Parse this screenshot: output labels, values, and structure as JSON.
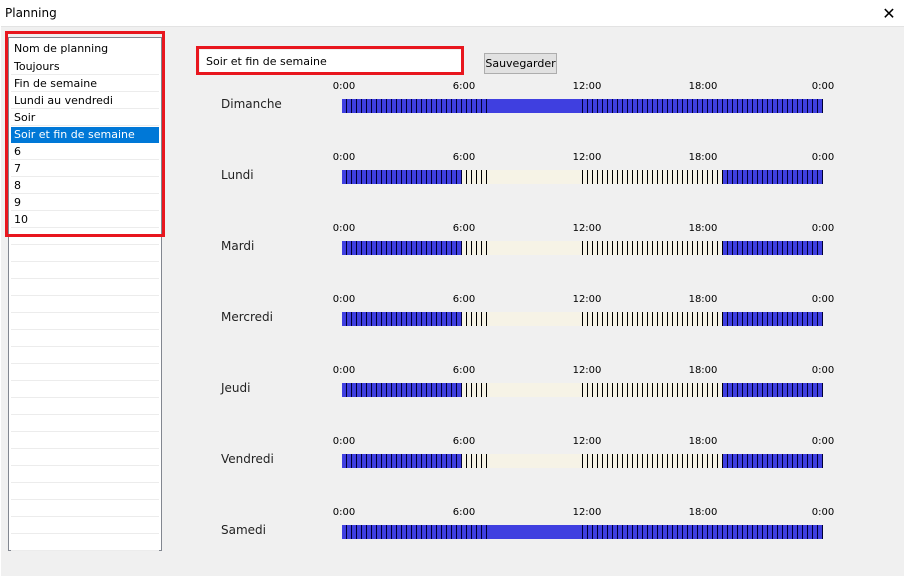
{
  "window": {
    "title": "Planning",
    "close_glyph": "✕"
  },
  "sidebar": {
    "header": "Nom de planning",
    "items": [
      "Toujours",
      "Fin de semaine",
      "Lundi au vendredi",
      "Soir",
      "Soir et fin de semaine",
      "6",
      "7",
      "8",
      "9",
      "10"
    ],
    "selected_index": 4
  },
  "editor": {
    "name_value": "Soir et fin de semaine",
    "save_label": "Sauvegarder"
  },
  "schedule": {
    "tick_labels": [
      "0:00",
      "6:00",
      "12:00",
      "18:00",
      "0:00"
    ],
    "slots_per_day": 96,
    "colors": {
      "active": "#3f3fe0",
      "inactive": "#f6f3e6",
      "highlight": "#e8161e",
      "selection": "#0078d7"
    },
    "days": [
      {
        "name": "Dimanche",
        "active_ranges": [
          [
            0,
            24
          ]
        ]
      },
      {
        "name": "Lundi",
        "active_ranges": [
          [
            0,
            6
          ],
          [
            19,
            24
          ]
        ]
      },
      {
        "name": "Mardi",
        "active_ranges": [
          [
            0,
            6
          ],
          [
            19,
            24
          ]
        ]
      },
      {
        "name": "Mercredi",
        "active_ranges": [
          [
            0,
            6
          ],
          [
            19,
            24
          ]
        ]
      },
      {
        "name": "Jeudi",
        "active_ranges": [
          [
            0,
            6
          ],
          [
            19,
            24
          ]
        ]
      },
      {
        "name": "Vendredi",
        "active_ranges": [
          [
            0,
            6
          ],
          [
            19,
            24
          ]
        ]
      },
      {
        "name": "Samedi",
        "active_ranges": [
          [
            0,
            24
          ]
        ]
      }
    ]
  }
}
